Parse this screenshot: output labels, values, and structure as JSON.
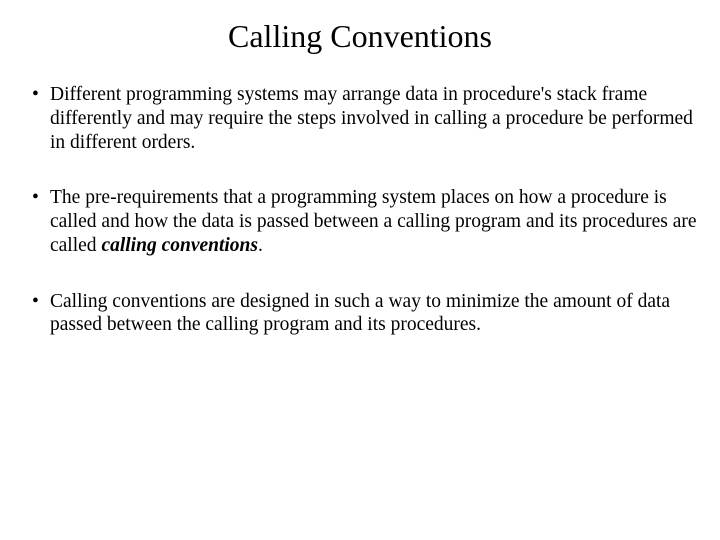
{
  "title": "Calling Conventions",
  "bullets": {
    "b1": "Different programming systems may arrange data in procedure's stack frame differently and may require the steps involved in calling a procedure be performed in different orders.",
    "b2_pre": "The pre-requirements that a programming system places on how a procedure is called and how the data is passed between a calling program and its procedures are called ",
    "b2_term": "calling conventions",
    "b2_post": ".",
    "b3": "Calling conventions are designed in such a way to minimize the amount of data passed between the calling program and its procedures."
  }
}
